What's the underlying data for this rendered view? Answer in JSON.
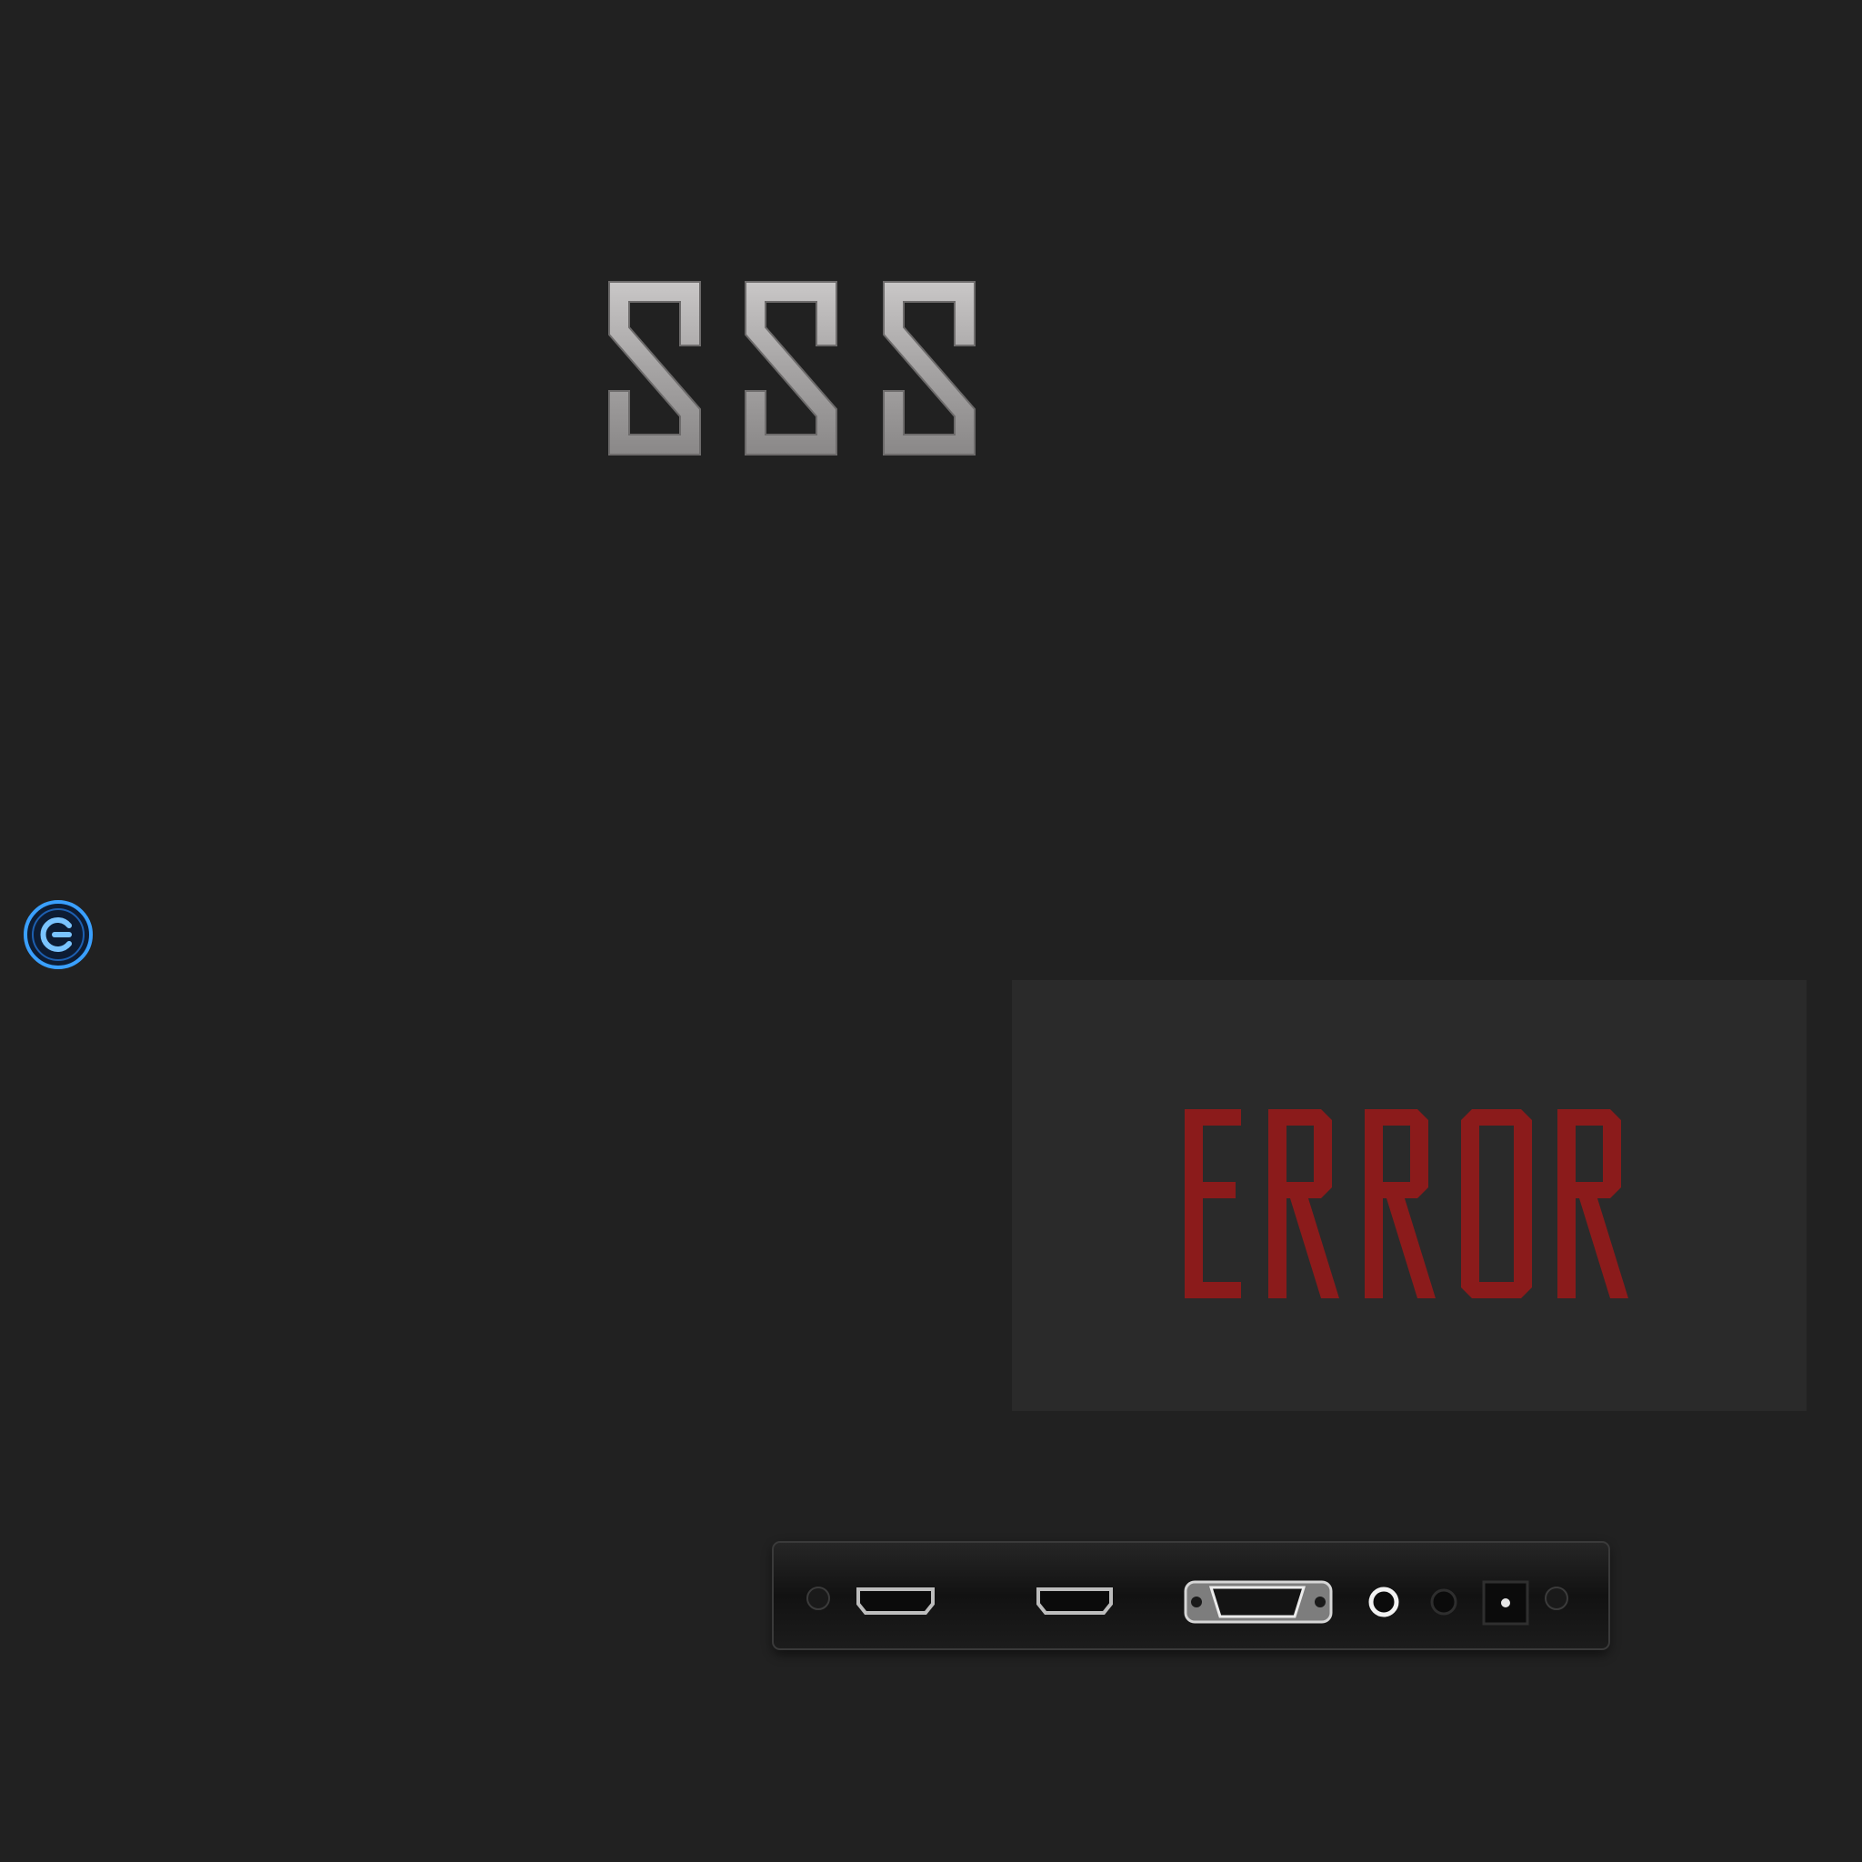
{
  "logo": {
    "text": "SSS",
    "color": "#a4a2a2"
  },
  "side_button": {
    "icon": "power-g-icon",
    "accent": "#3aa0ff"
  },
  "error_panel": {
    "text": "ERROR",
    "color": "#8b1b1b"
  },
  "device": {
    "icon": "io-port-panel",
    "ports": [
      "hdmi",
      "hdmi",
      "vga",
      "audio",
      "headphone",
      "dc-power"
    ]
  }
}
